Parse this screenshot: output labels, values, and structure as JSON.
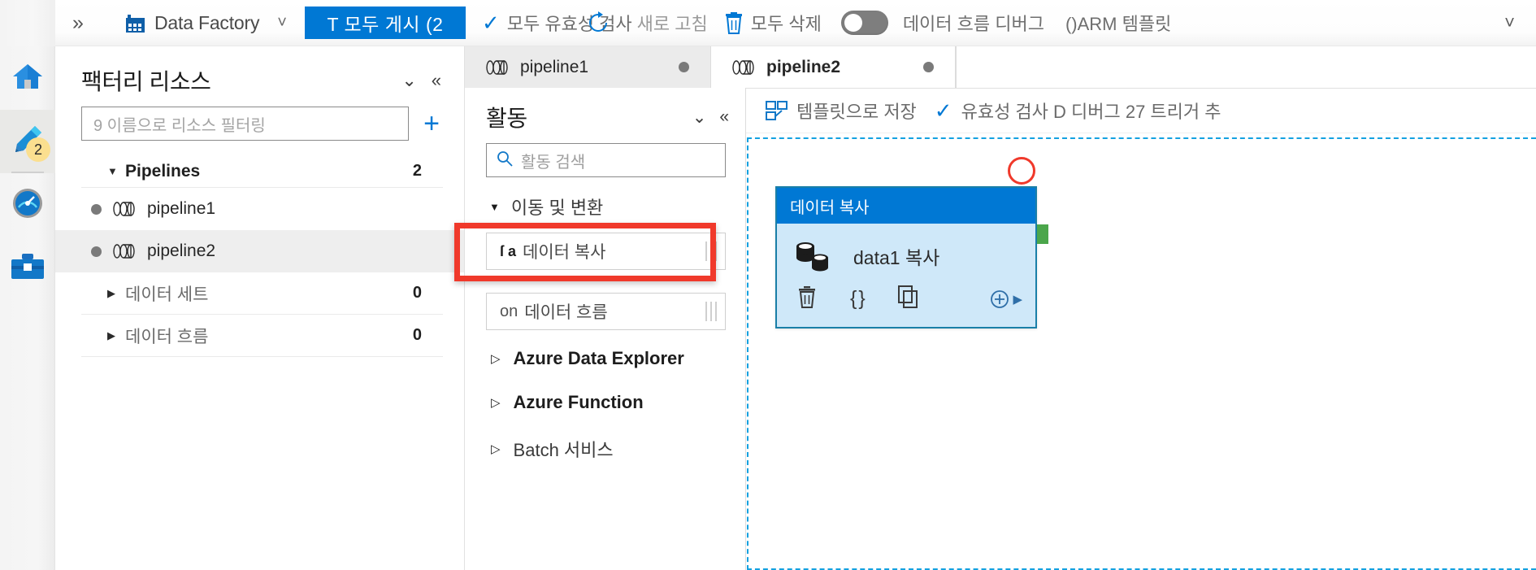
{
  "topbar": {
    "expand_icon": "chevron-double-right-icon",
    "logo_icon": "data-factory-logo-icon",
    "title": "Data Factory",
    "title_caret": "chevron-down-icon",
    "publish_label": "T 모두 게시 (2",
    "validate_all_label": "모두 유효성 검사",
    "refresh_label": "새로 고침",
    "delete_all_label": "모두 삭제",
    "data_flow_debug_label": "데이터 흐름 디버그",
    "arm_template_label": "()ARM 템플릿",
    "end_caret": "chevron-down-icon",
    "toggle_state": "off"
  },
  "rail": {
    "items": [
      {
        "icon": "home-icon",
        "active": false,
        "badge": ""
      },
      {
        "icon": "pencil-author-icon",
        "active": true,
        "badge": "2"
      },
      {
        "icon": "monitor-gauge-icon",
        "active": false,
        "badge": ""
      },
      {
        "icon": "toolbox-manage-icon",
        "active": false,
        "badge": ""
      }
    ]
  },
  "resources": {
    "title": "팩터리 리소스",
    "collapse_all_icon": "chevron-double-down-icon",
    "collapse_icon": "chevron-double-left-icon",
    "filter_placeholder": "9 이름으로 리소스 필터링",
    "add_label": "+",
    "groups": [
      {
        "label": "Pipelines",
        "count": "2",
        "expanded": true,
        "bold": true
      },
      {
        "label": "데이터 세트",
        "count": "0",
        "expanded": false,
        "bold": false
      },
      {
        "label": "데이터 흐름",
        "count": "0",
        "expanded": false,
        "bold": false
      }
    ],
    "pipelines": [
      {
        "label": "pipeline1",
        "selected": false
      },
      {
        "label": "pipeline2",
        "selected": true
      }
    ]
  },
  "activities": {
    "title": "활동",
    "collapse_all_icon": "chevron-double-down-icon",
    "collapse_icon": "chevron-double-left-icon",
    "search_placeholder": "활동 검색",
    "search_icon": "search-icon",
    "group_label": "이동 및  변환",
    "items": [
      {
        "prefix": "ſ a",
        "label": "데이터 복사",
        "highlighted": true
      },
      {
        "prefix": "on",
        "label": "데이터 흐름",
        "highlighted": false
      }
    ],
    "collapsed_groups": [
      {
        "label": "Azure Data Explorer",
        "bold": true
      },
      {
        "label": "Azure Function",
        "bold": true
      },
      {
        "label": "Batch 서비스",
        "bold": false
      }
    ]
  },
  "tabs": [
    {
      "label": "pipeline1",
      "active": false,
      "icon": "pipeline-icon",
      "dot": true
    },
    {
      "label": "pipeline2",
      "active": true,
      "icon": "pipeline-icon",
      "dot": true
    }
  ],
  "pipeline_toolbar": {
    "save_as_template_icon": "save-template-icon",
    "save_as_template_label": "템플릿으로 저장",
    "validate_icon": "check-icon",
    "validate_label": "유효성 검사 D 디버그 27 트리거 추"
  },
  "canvas": {
    "annotation_circle": "red-circle-annotation",
    "node": {
      "header": "데이터 복사",
      "icon": "database-copy-icon",
      "label": "data1 복사",
      "actions": [
        {
          "icon": "trash-icon",
          "glyph": "🗑"
        },
        {
          "icon": "code-braces-icon",
          "glyph": "{ }"
        },
        {
          "icon": "copy-icon",
          "glyph": "⧉"
        },
        {
          "icon": "add-output-icon",
          "glyph": "⊕"
        }
      ]
    }
  },
  "colors": {
    "accent": "#0078d4",
    "highlight_red": "#f0392b",
    "node_body": "#cfe8f9",
    "node_border": "#1a7fa8",
    "badge_yellow": "#fbdf8f",
    "dashed_blue": "#14a1e0",
    "green_tab": "#4ba64b"
  }
}
